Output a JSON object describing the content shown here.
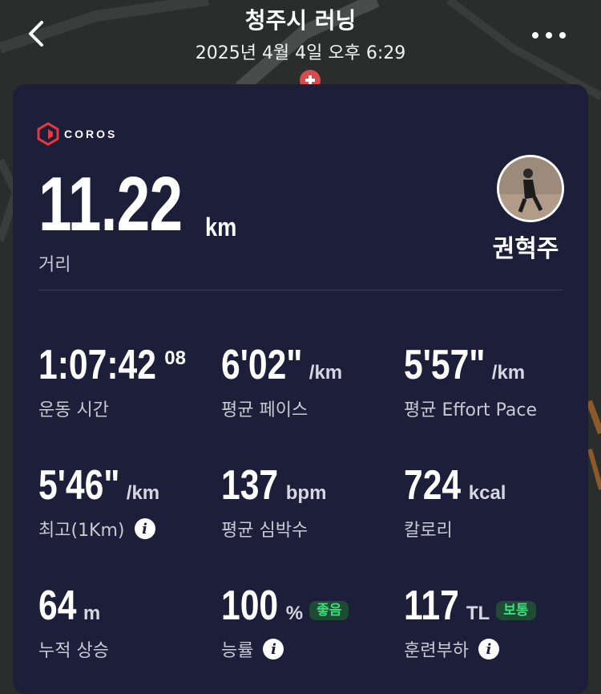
{
  "header": {
    "title": "청주시 러닝",
    "subtitle": "2025년 4월 4일 오후 6:29"
  },
  "brand": {
    "name": "COROS",
    "accent": "#e8383d"
  },
  "summary": {
    "distance_value": "11.22",
    "distance_unit": "km",
    "distance_label": "거리",
    "user_name": "권혁주"
  },
  "stats": [
    {
      "value": "1:07:42",
      "suffix": "08",
      "unit": "",
      "label": "운동 시간"
    },
    {
      "value": "6'02\"",
      "unit": "/km",
      "label": "평균 페이스"
    },
    {
      "value": "5'57\"",
      "unit": "/km",
      "label": "평균 Effort Pace"
    },
    {
      "value": "5'46\"",
      "unit": "/km",
      "label": "최고(1Km)"
    },
    {
      "value": "137",
      "unit": "bpm",
      "label": "평균 심박수"
    },
    {
      "value": "724",
      "unit": "kcal",
      "label": "칼로리"
    },
    {
      "value": "64",
      "unit": "m",
      "label": "누적 상승"
    },
    {
      "value": "100",
      "unit": "%",
      "badge": "좋음",
      "label": "능률"
    },
    {
      "value": "117",
      "unit": "TL",
      "badge": "보통",
      "label": "훈련부하"
    }
  ],
  "colors": {
    "card_bg": "#1c1e3a",
    "badge_green": "#3ddc7a",
    "badge_bg": "#1f4a34"
  }
}
